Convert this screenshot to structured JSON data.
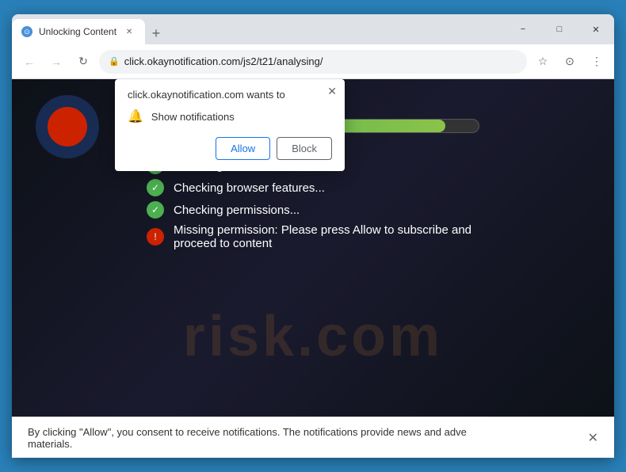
{
  "browser": {
    "tab": {
      "favicon_symbol": "⊙",
      "label": "Unlocking Content",
      "close_symbol": "✕"
    },
    "new_tab_symbol": "+",
    "window_controls": {
      "minimize": "−",
      "maximize": "□",
      "close": "✕"
    },
    "nav": {
      "back_symbol": "←",
      "forward_symbol": "→",
      "refresh_symbol": "↻",
      "lock_symbol": "🔒",
      "address": "click.okaynotification.com/js2/t21/analysing/",
      "star_symbol": "☆",
      "profile_symbol": "⊙",
      "menu_symbol": "⋮"
    }
  },
  "popup": {
    "close_symbol": "✕",
    "title": "click.okaynotification.com wants to",
    "permission_bell": "🔔",
    "permission_text": "Show notifications",
    "allow_label": "Allow",
    "block_label": "Block"
  },
  "page": {
    "progress_width": "90%",
    "check_items": [
      {
        "type": "green",
        "text": "Checking browser information..."
      },
      {
        "type": "green",
        "text": "Checking browser features..."
      },
      {
        "type": "green",
        "text": "Checking permissions..."
      },
      {
        "type": "warn",
        "text": "Missing permission: Please press Allow to subscribe and proceed to content"
      }
    ],
    "watermark": "risk.com",
    "check_symbol": "✓",
    "warn_symbol": "!"
  },
  "bottom_bar": {
    "text_line1": "By clicking \"Allow\", you consent to receive notifications. The notifications provide news and adve",
    "text_line2": "materials.",
    "close_symbol": "✕"
  }
}
